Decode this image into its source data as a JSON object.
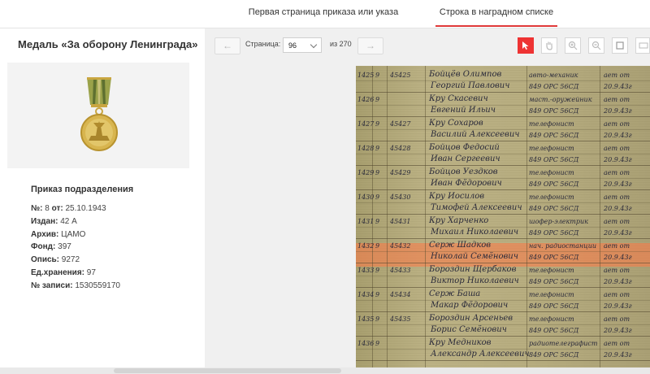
{
  "tabs": [
    {
      "label": "Первая страница приказа или указа",
      "active": false
    },
    {
      "label": "Строка в наградном списке",
      "active": true
    }
  ],
  "sidebar": {
    "medal_title": "Медаль «За оборону Ленинграда»",
    "order_heading": "Приказ подразделения",
    "fields": [
      {
        "label": "№:",
        "value": "8"
      },
      {
        "label": "от:",
        "value": "25.10.1943"
      },
      {
        "label": "Издан:",
        "value": "42 А"
      },
      {
        "label": "Архив:",
        "value": "ЦАМО"
      },
      {
        "label": "Фонд:",
        "value": "397"
      },
      {
        "label": "Опись:",
        "value": "9272"
      },
      {
        "label": "Ед.хранения:",
        "value": "97"
      },
      {
        "label": "№ записи:",
        "value": "1530559170"
      }
    ]
  },
  "viewer": {
    "prev_icon": "←",
    "next_icon": "→",
    "page_label": "Страница:",
    "current_page": "96",
    "of_label": "из 270",
    "tools": [
      "pointer-icon",
      "hand-icon",
      "zoom-in-icon",
      "zoom-out-icon",
      "fit-page-icon",
      "actual-size-icon"
    ],
    "accent_color": "#e33333"
  },
  "scan_rows": [
    {
      "n": "1425",
      "num": "45425",
      "name1": "Бойцёв Олимпов",
      "name2": "Георгий Павлович",
      "unit1": "авто-механик",
      "unit2": "849 ОРС 56СД",
      "st1": "ает от",
      "st2": "20.9.43г"
    },
    {
      "n": "1426",
      "num": "",
      "name1": "Кру Скасевич",
      "name2": "Евгений Ильич",
      "unit1": "маст.-оружейник",
      "unit2": "849 ОРС 56СД",
      "st1": "ает от",
      "st2": "20.9.43г"
    },
    {
      "n": "1427",
      "num": "45427",
      "name1": "Кру Сохаров",
      "name2": "Василий Алексеевич",
      "unit1": "телефонист",
      "unit2": "849 ОРС 56СД",
      "st1": "ает от",
      "st2": "20.9.43г"
    },
    {
      "n": "1428",
      "num": "45428",
      "name1": "Бойцов Федосий",
      "name2": "Иван Сергеевич",
      "unit1": "телефонист",
      "unit2": "849 ОРС 56СД",
      "st1": "ает от",
      "st2": "20.9.43г"
    },
    {
      "n": "1429",
      "num": "45429",
      "name1": "Бойцов Уездков",
      "name2": "Иван Фёдорович",
      "unit1": "телефонист",
      "unit2": "849 ОРС 56СД",
      "st1": "ает от",
      "st2": "20.9.43г"
    },
    {
      "n": "1430",
      "num": "45430",
      "name1": "Кру Иосилов",
      "name2": "Тимофей Алексеевич",
      "unit1": "телефонист",
      "unit2": "849 ОРС 56СД",
      "st1": "ает от",
      "st2": "20.9.43г"
    },
    {
      "n": "1431",
      "num": "45431",
      "name1": "Кру Харченко",
      "name2": "Михаил Николаевич",
      "unit1": "шофер-электрик",
      "unit2": "849 ОРС 56СД",
      "st1": "ает от",
      "st2": "20.9.43г"
    },
    {
      "n": "1432",
      "num": "45432",
      "name1": "Серж Шадков",
      "name2": "Николай Семёнович",
      "unit1": "нач. радиостанции",
      "unit2": "849 ОРС 56СД",
      "st1": "ает от",
      "st2": "20.9.43г"
    },
    {
      "n": "1433",
      "num": "45433",
      "name1": "Бороздин Щербаков",
      "name2": "Виктор Николаевич",
      "unit1": "телефонист",
      "unit2": "849 ОРС 56СД",
      "st1": "ает от",
      "st2": "20.9.43г"
    },
    {
      "n": "1434",
      "num": "45434",
      "name1": "Серж Баша",
      "name2": "Макар Фёдорович",
      "unit1": "телефонист",
      "unit2": "849 ОРС 56СД",
      "st1": "ает от",
      "st2": "20.9.43г"
    },
    {
      "n": "1435",
      "num": "45435",
      "name1": "Бороздин Арсеньев",
      "name2": "Борис Семёнович",
      "unit1": "телефонист",
      "unit2": "849 ОРС 56СД",
      "st1": "ает от",
      "st2": "20.9.43г"
    },
    {
      "n": "1436",
      "num": "",
      "name1": "Кру Медников",
      "name2": "Александр Алексеевич",
      "unit1": "радиотелеграфист",
      "unit2": "849 ОРС 56СД",
      "st1": "ает от",
      "st2": "20.9.43г"
    }
  ]
}
